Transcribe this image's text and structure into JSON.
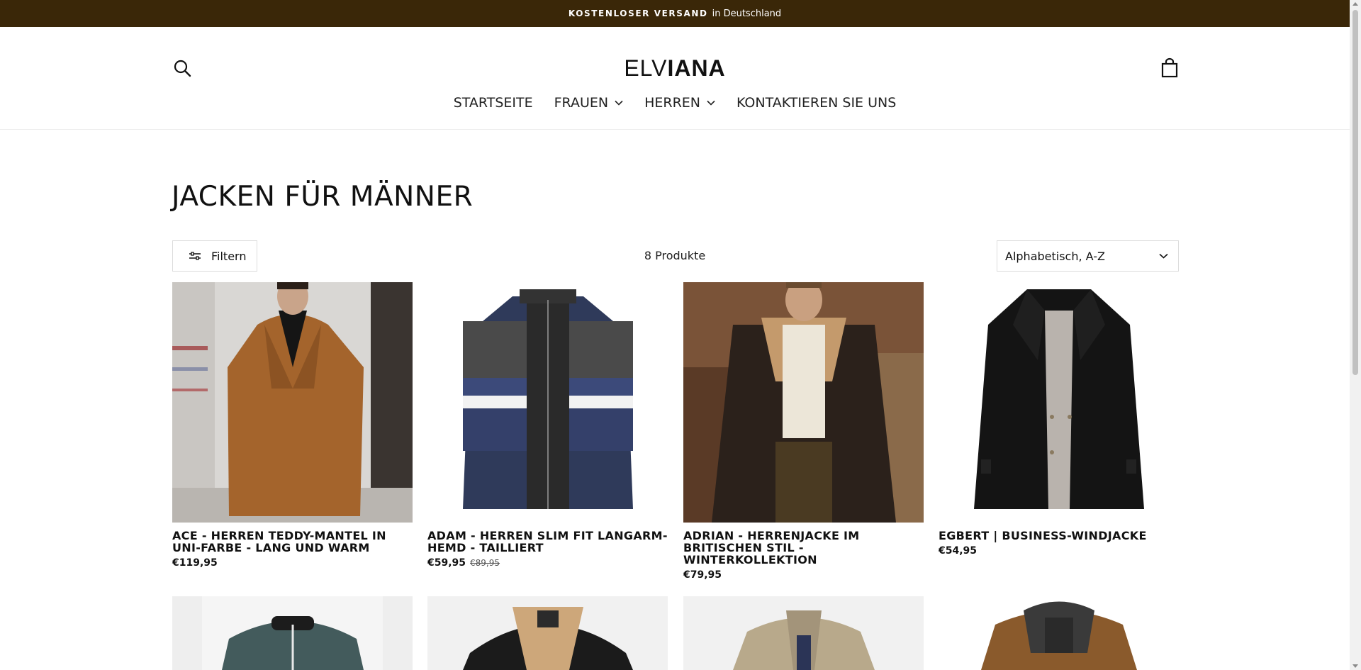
{
  "announcement": {
    "strong": "KOSTENLOSER VERSAND",
    "text": "in Deutschland"
  },
  "header": {
    "logo_light": "ELV",
    "logo_bold": "IANA",
    "nav": [
      {
        "label": "STARTSEITE",
        "has_dropdown": false
      },
      {
        "label": "FRAUEN",
        "has_dropdown": true
      },
      {
        "label": "HERREN",
        "has_dropdown": true
      },
      {
        "label": "KONTAKTIEREN SIE UNS",
        "has_dropdown": false
      }
    ],
    "icons": {
      "search": "search-icon",
      "cart": "shopping-bag-icon"
    }
  },
  "collection": {
    "title": "JACKEN FÜR MÄNNER",
    "filter_label": "Filtern",
    "count": "8 Produkte",
    "sort_value": "Alphabetisch, A-Z"
  },
  "products": [
    {
      "title": "ACE - HERREN TEDDY-MANTEL IN UNI-FARBE - LANG UND WARM",
      "price": "€119,95",
      "old_price": ""
    },
    {
      "title": "ADAM - HERREN SLIM FIT LANGARM-HEMD - TAILLIERT",
      "price": "€59,95",
      "old_price": "€89,95"
    },
    {
      "title": "ADRIAN - HERRENJACKE IM BRITISCHEN STIL - WINTERKOLLEKTION",
      "price": "€79,95",
      "old_price": ""
    },
    {
      "title": "EGBERT | BUSINESS-WINDJACKE",
      "price": "€54,95",
      "old_price": ""
    }
  ],
  "colors": {
    "announcement_bg": "#3a2708",
    "text": "#111111",
    "border": "#dcdcdc"
  }
}
